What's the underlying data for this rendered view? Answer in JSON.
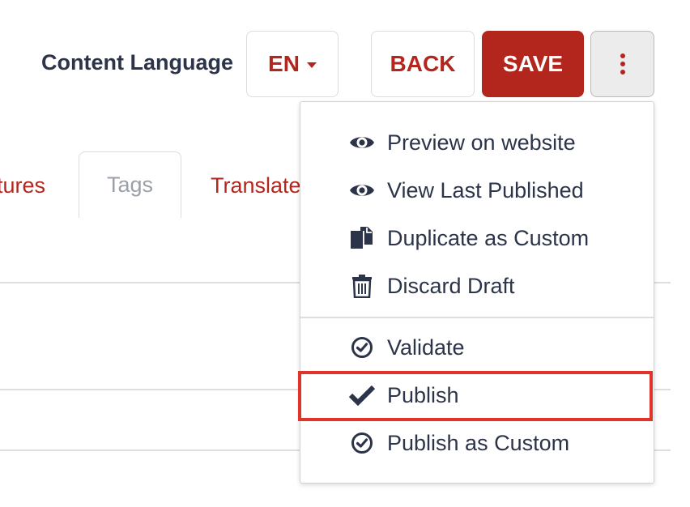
{
  "header": {
    "content_language_label": "Content Language",
    "language_value": "EN",
    "back_label": "BACK",
    "save_label": "SAVE"
  },
  "tabs": [
    {
      "label": "tures"
    },
    {
      "label": "Tags"
    },
    {
      "label": "Translate"
    }
  ],
  "menu": {
    "items": [
      {
        "label": "Preview on website",
        "icon": "eye-icon"
      },
      {
        "label": "View Last Published",
        "icon": "eye-icon"
      },
      {
        "label": "Duplicate as Custom",
        "icon": "copy-icon"
      },
      {
        "label": "Discard Draft",
        "icon": "trash-icon"
      },
      {
        "label": "Validate",
        "icon": "check-circle-icon"
      },
      {
        "label": "Publish",
        "icon": "check-icon"
      },
      {
        "label": "Publish as Custom",
        "icon": "check-circle-icon"
      }
    ],
    "highlighted": "Publish"
  },
  "colors": {
    "accent": "#b3261e",
    "text": "#2b3448",
    "highlight": "#e0332a",
    "muted_tab": "#9aa0a8"
  }
}
